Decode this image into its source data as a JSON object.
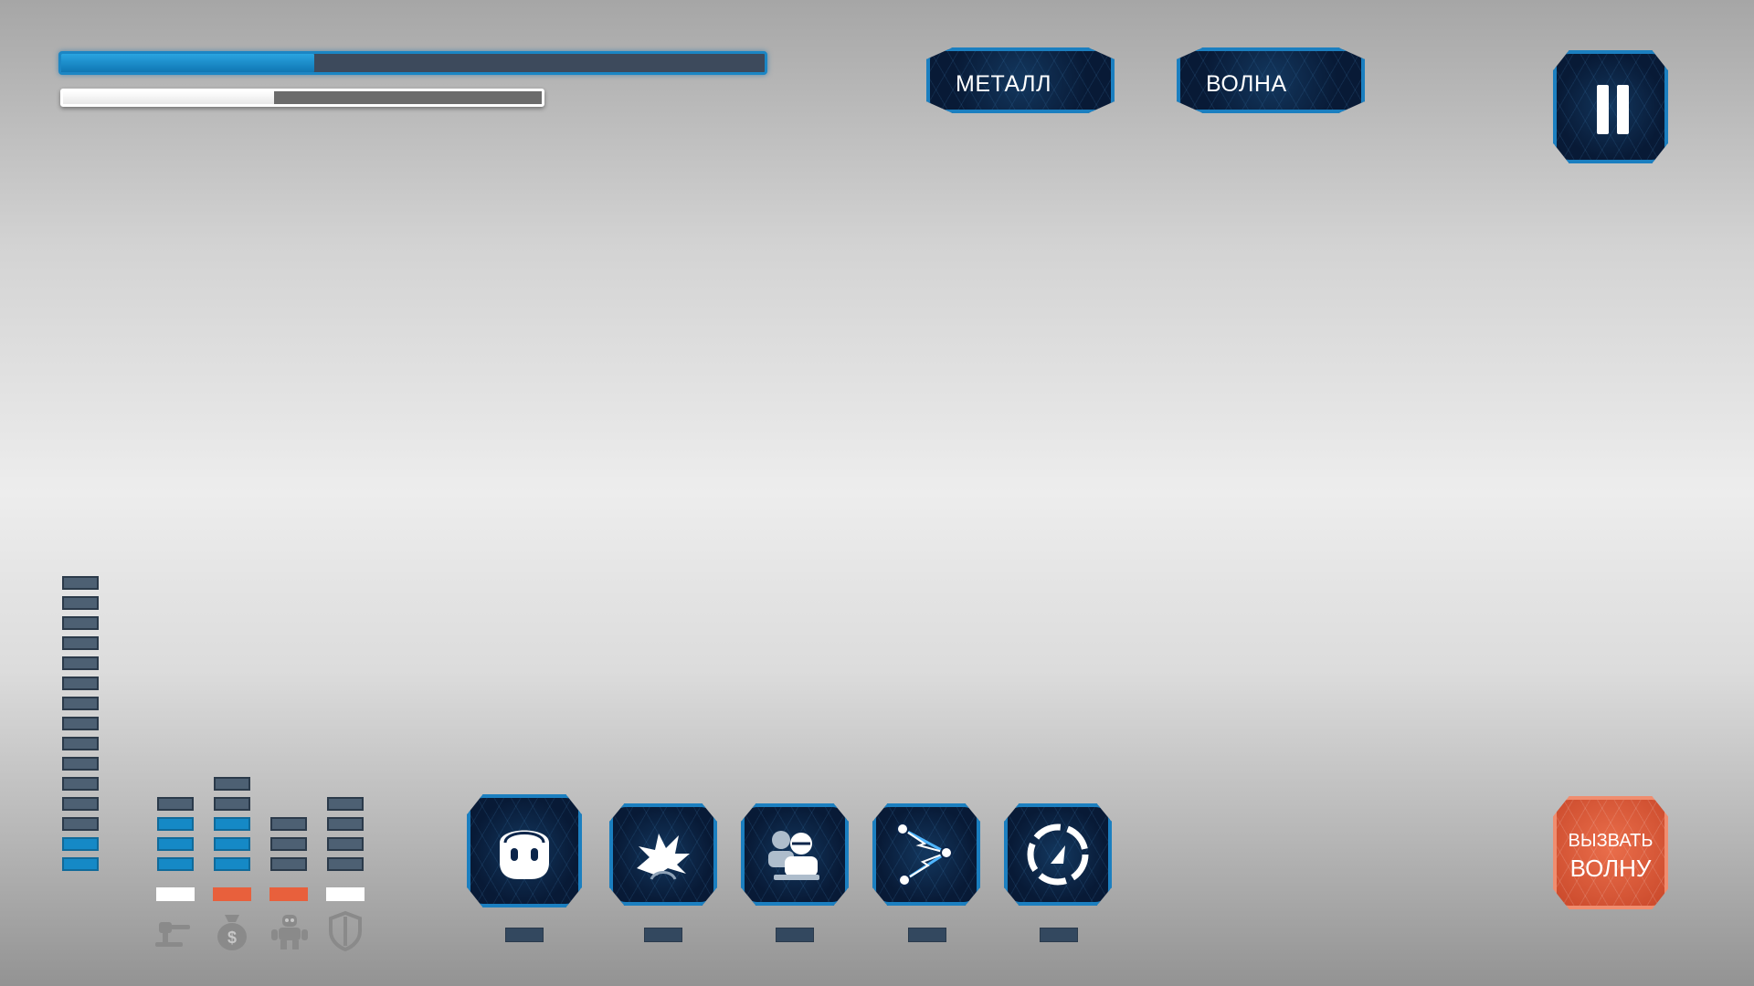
{
  "hud": {
    "health_bar": {
      "fill_percent": 36,
      "color": "#1b86c4"
    },
    "experience_bar": {
      "fill_percent": 44,
      "color": "#ffffff"
    },
    "metal_label": "МЕТАЛЛ",
    "wave_label": "ВОЛНА",
    "pause_icon": "pause-icon"
  },
  "resource_meter": {
    "segments_total": 15,
    "segments_filled": 2
  },
  "stats": [
    {
      "name": "turret",
      "icon": "turret-icon",
      "segments_total": 4,
      "segments_filled": 3,
      "indicator": "white"
    },
    {
      "name": "money",
      "icon": "money-bag-icon",
      "segments_total": 5,
      "segments_filled": 3,
      "indicator": "orange"
    },
    {
      "name": "robot",
      "icon": "robot-icon",
      "segments_total": 3,
      "segments_filled": 0,
      "indicator": "orange"
    },
    {
      "name": "shield",
      "icon": "shield-icon",
      "segments_total": 4,
      "segments_filled": 0,
      "indicator": "white"
    }
  ],
  "abilities": [
    {
      "icon": "robot-head-icon",
      "active": true
    },
    {
      "icon": "explosion-icon",
      "active": false
    },
    {
      "icon": "soldiers-icon",
      "active": false
    },
    {
      "icon": "lightning-chain-icon",
      "active": false
    },
    {
      "icon": "cooldown-timer-icon",
      "active": false
    }
  ],
  "call_wave": {
    "line1": "ВЫЗВАТЬ",
    "line2": "ВОЛНУ",
    "color": "#e25c39"
  }
}
